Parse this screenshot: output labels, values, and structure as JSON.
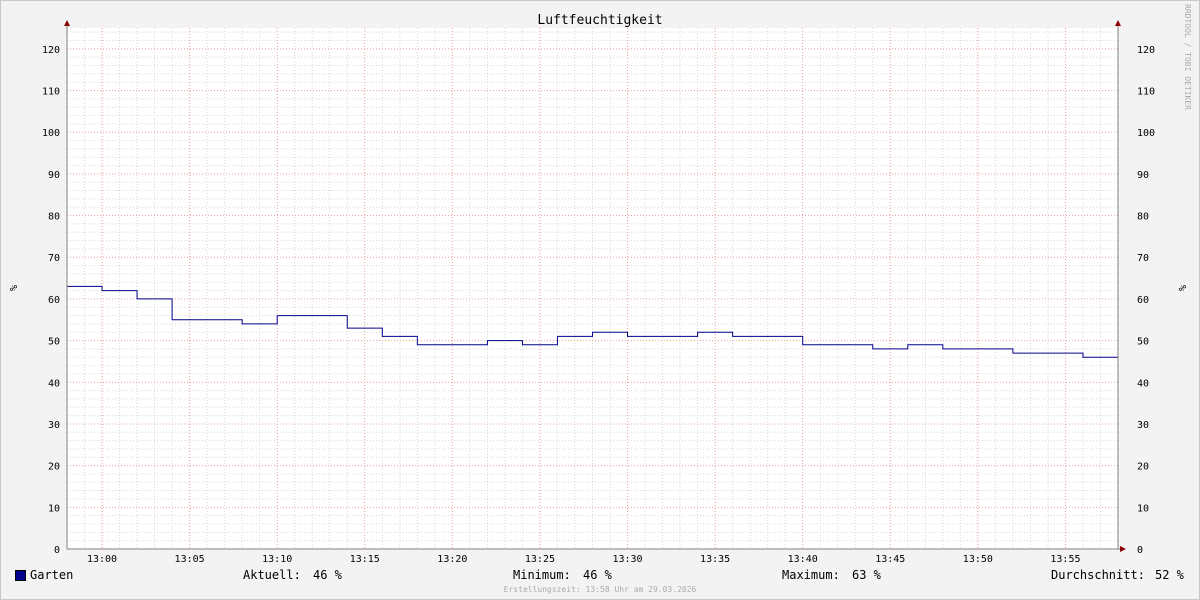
{
  "colors": {
    "background": "#f3f3f3",
    "canvas": "#ffffff",
    "series": "#00008b",
    "major_grid": "#e8a0a0",
    "minor_grid": "#d8d8d8",
    "axis": "#808080",
    "arrow": "#8b0000"
  },
  "watermark": "RRDTOOL / TOBI OETIKER",
  "footer_text": "Erstellungszeit: 13:58 Uhr am 29.03.2026",
  "legend": {
    "name": "Garten",
    "stats": {
      "current_label": "Aktuell:",
      "current_value": "46 %",
      "min_label": "Minimum:",
      "min_value": "46 %",
      "max_label": "Maximum:",
      "max_value": "63 %",
      "avg_label": "Durchschnitt:",
      "avg_value": "52 %"
    }
  },
  "chart_data": {
    "type": "line",
    "title": "Luftfeuchtigkeit",
    "ylabel": "%",
    "ylabel_right": "%",
    "ylim": [
      0,
      125
    ],
    "yticks": [
      0,
      10,
      20,
      30,
      40,
      50,
      60,
      70,
      80,
      90,
      100,
      110,
      120
    ],
    "xlim": [
      "12:58",
      "13:58"
    ],
    "xticks": [
      "13:00",
      "13:05",
      "13:10",
      "13:15",
      "13:20",
      "13:25",
      "13:30",
      "13:35",
      "13:40",
      "13:45",
      "13:50",
      "13:55"
    ],
    "grid": true,
    "series": [
      {
        "name": "Garten",
        "step": true,
        "x": [
          "12:58",
          "13:00",
          "13:02",
          "13:04",
          "13:06",
          "13:08",
          "13:10",
          "13:12",
          "13:14",
          "13:16",
          "13:18",
          "13:20",
          "13:22",
          "13:24",
          "13:26",
          "13:28",
          "13:30",
          "13:32",
          "13:34",
          "13:36",
          "13:38",
          "13:40",
          "13:42",
          "13:44",
          "13:46",
          "13:48",
          "13:50",
          "13:52",
          "13:54",
          "13:56"
        ],
        "values": [
          63,
          62,
          60,
          55,
          55,
          54,
          56,
          56,
          53,
          51,
          49,
          49,
          50,
          49,
          51,
          52,
          51,
          51,
          52,
          51,
          51,
          49,
          49,
          48,
          49,
          48,
          48,
          47,
          47,
          46
        ]
      }
    ]
  }
}
